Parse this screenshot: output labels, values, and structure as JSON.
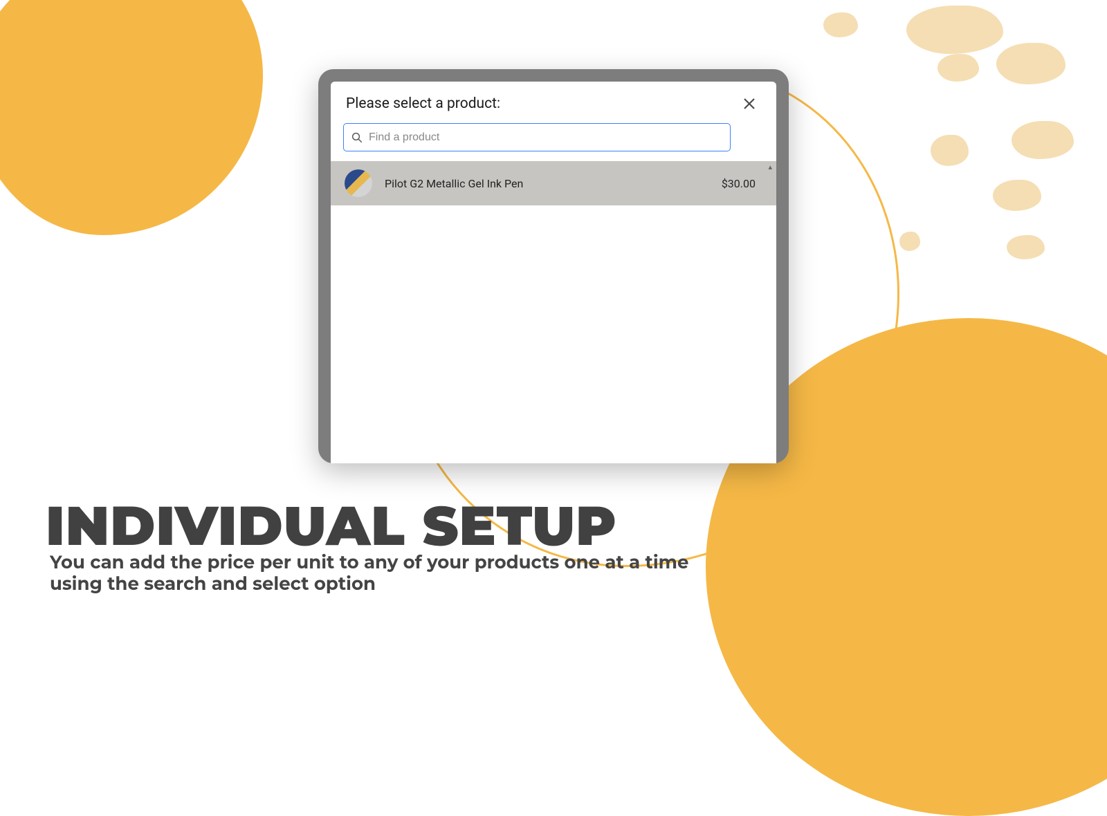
{
  "modal": {
    "title": "Please select a product:",
    "search": {
      "placeholder": "Find a product",
      "value": ""
    },
    "products": [
      {
        "name": "Pilot G2 Metallic Gel Ink Pen",
        "price": "$30.00"
      }
    ]
  },
  "page": {
    "headline": "INDIVIDUAL SETUP",
    "subline": "You can add the price per unit to any of your products one at a time using the search and select option"
  },
  "colors": {
    "accent": "#f5b846",
    "focus": "#3b82f6"
  }
}
